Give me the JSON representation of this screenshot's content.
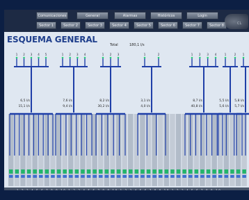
{
  "header": {
    "nav_buttons": [
      {
        "label": "Comunicaciones"
      },
      {
        "label": "General"
      },
      {
        "label": "Alarmas"
      },
      {
        "label": "Históricos"
      },
      {
        "label": "Login"
      }
    ],
    "sector_buttons": [
      {
        "label": "Sector 1"
      },
      {
        "label": "Sector 2"
      },
      {
        "label": "Sector 3"
      },
      {
        "label": "Sector 4"
      },
      {
        "label": "Sector 5"
      },
      {
        "label": "Sector 6"
      },
      {
        "label": "Sector 7"
      },
      {
        "label": "Sector 8"
      }
    ],
    "logo_text": "CL"
  },
  "main": {
    "title": "ESQUEMA GENERAL",
    "total_label": "Total",
    "total_value": "180,1 l/s"
  },
  "groups": [
    {
      "flow_a": "6,5 l/s",
      "flow_b": "15,1 l/s",
      "valves": [
        "1",
        "2",
        "3",
        "4",
        "5"
      ]
    },
    {
      "flow_a": "7,6 l/s",
      "flow_b": "9,4 l/s",
      "valves": [
        "1",
        "2",
        "3",
        "4"
      ]
    },
    {
      "flow_a": "8,2 l/s",
      "flow_b": "30,2 l/s",
      "valves": [
        "1",
        "2",
        "3"
      ]
    },
    {
      "flow_a": "3,1 l/s",
      "flow_b": "4,0 l/s",
      "valves": [
        "1",
        "2"
      ]
    },
    {
      "flow_a": "8,7 l/s",
      "flow_b": "40,8 l/s",
      "valves": [
        "1",
        "2",
        "3",
        "4"
      ]
    },
    {
      "flow_a": "5,5 l/s",
      "flow_b": "5,6 l/s",
      "valves": [
        "1",
        "2"
      ]
    },
    {
      "flow_a": "5,8 l/s",
      "flow_b": "5,7 l/s",
      "valves": [
        "1"
      ]
    }
  ],
  "footer": {
    "sector_labels": [
      "SECTOR 1",
      "SECTOR 2",
      "SECTOR 3"
    ],
    "numbers_row": "1 2 3 4 5 6 7 8 9 10 1 2 3 4 5 6 7 8 9 10 1 2 3 4 5 6 7 8 9 10 1 2 3 4 5 6 7 8 9 10"
  },
  "colors": {
    "pipe": "#1f3fa8",
    "accent": "#2bd47a",
    "header": "#1d2a44"
  }
}
